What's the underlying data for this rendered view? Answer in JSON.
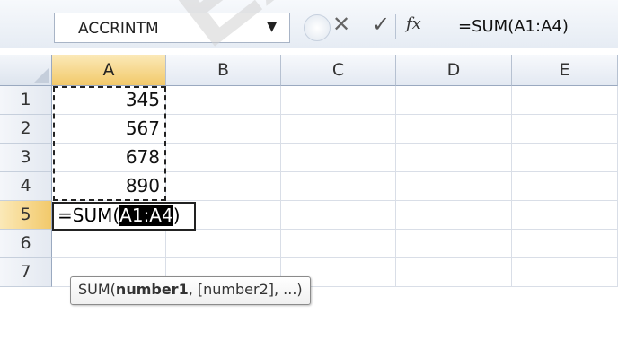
{
  "name_box": {
    "value": "ACCRINTM",
    "dropdown_icon": "triangle-down"
  },
  "watermark": {
    "text": "EXL"
  },
  "formula_bar": {
    "cancel_icon": "✕",
    "enter_icon": "✓",
    "function_icon": "fx",
    "formula": "=SUM(A1:A4)"
  },
  "columns": [
    "A",
    "B",
    "C",
    "D",
    "E"
  ],
  "rows": [
    "1",
    "2",
    "3",
    "4",
    "5",
    "6",
    "7"
  ],
  "cells": {
    "A1": "345",
    "A2": "567",
    "A3": "678",
    "A4": "890"
  },
  "editing_cell": {
    "prefix": "=SUM(",
    "highlighted_ref": "A1:A4",
    "suffix": ")"
  },
  "function_tooltip": {
    "name": "SUM(",
    "bold_arg": "number1",
    "rest": ", [number2], ...)"
  },
  "colors": {
    "active_header": "#f2c96a",
    "grid_line": "#d9dee7"
  }
}
